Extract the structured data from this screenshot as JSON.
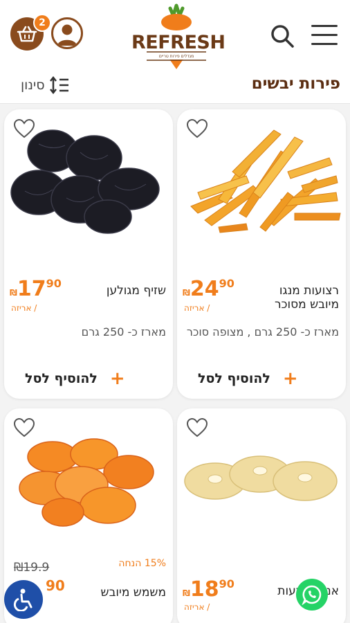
{
  "header": {
    "cart_count": "2",
    "logo_text": "REFRESH",
    "logo_subtitle": "מגדלים פירות טריים"
  },
  "titlebar": {
    "title": "פירות יבשים",
    "filter_label": "סינון"
  },
  "products": [
    {
      "name": "רצועות מנגו מיובש מסוכר",
      "price_int": "24",
      "price_dec": "90",
      "currency": "₪",
      "unit": "/ אריזה",
      "description": "מארז כ- 250 גרם , מצופה סוכר",
      "add_label": "להוסיף לסל"
    },
    {
      "name": "שזיף מגולען",
      "price_int": "17",
      "price_dec": "90",
      "currency": "₪",
      "unit": "/ אריזה",
      "description": "מארז כ- 250 גרם",
      "add_label": "להוסיף לסל"
    },
    {
      "name": "אננס טבעות",
      "price_int": "18",
      "price_dec": "90",
      "currency": "₪",
      "unit": "/ אריזה"
    },
    {
      "name": "משמש מיובש",
      "discount": "15% הנחה",
      "old_price": "₪19.9",
      "price_dec": "90"
    }
  ],
  "colors": {
    "accent": "#f07d1b",
    "brand_brown": "#5a2c10"
  }
}
